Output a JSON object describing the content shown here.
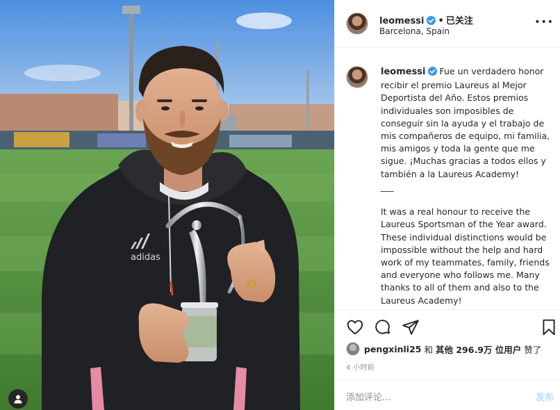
{
  "post": {
    "username": "leomessi",
    "follow_label": "已关注",
    "location": "Barcelona, Spain",
    "more_label": "•••",
    "caption_es": "Fue un verdadero honor recibir el premio Laureus al Mejor Deportista del Año. Estos premios individuales son imposibles de conseguir sin la ayuda y el trabajo de mis compañeros de equipo, mi familia, mis amigos y toda la gente que me sigue. ¡Muchas gracias a todos ellos y también a la Laureus Academy!",
    "caption_sep": "___",
    "caption_en": "It was a real honour to receive the Laureus Sportsman of the Year award. These individual distinctions would be impossible without the help and hard work of my teammates, family, friends and everyone who follows me. Many thanks to all of them and also to the Laureus Academy!"
  },
  "photo": {
    "brand_text": "adidas"
  },
  "likes": {
    "liker": "pengxinli25",
    "and_label": "和",
    "others_label": "其他 296.9万 位用户",
    "liked_label": "赞了"
  },
  "time_ago": "4 小时前",
  "comment": {
    "placeholder": "添加评论...",
    "post_label": "发布"
  },
  "icons": {
    "like": "heart-icon",
    "comment": "comment-icon",
    "share": "share-icon",
    "save": "bookmark-icon",
    "user_tag": "user-tag-icon",
    "verified": "verified-badge-icon"
  },
  "colors": {
    "verified_blue": "#3897f0",
    "post_button_disabled": "#b2dffc",
    "secondary_text": "#8e8e8e"
  }
}
